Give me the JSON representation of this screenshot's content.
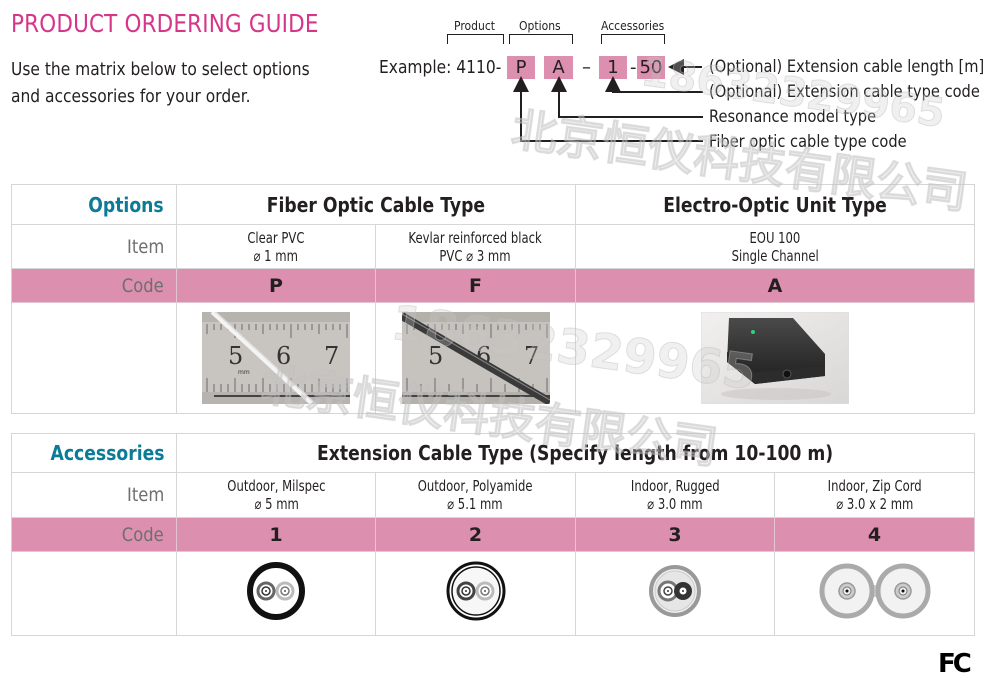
{
  "header": {
    "title": "PRODUCT ORDERING GUIDE",
    "intro_lines": [
      "Use the matrix below to select options",
      "and accessories for your order."
    ]
  },
  "example": {
    "prefix": "Example: 4110-",
    "group_labels": {
      "product": "Product",
      "options": "Options",
      "accessories": "Accessories"
    },
    "codes": [
      "P",
      "A",
      "1",
      "50"
    ],
    "separators": [
      "–",
      "-"
    ],
    "legend": [
      "(Optional) Extension cable length [m]",
      "(Optional) Extension cable type code",
      "Resonance model type",
      "Fiber optic cable type code"
    ],
    "highlight_color": "#dc8fae"
  },
  "options_table": {
    "section_label": "Options",
    "groups": [
      "Fiber Optic Cable Type",
      "Electro-Optic Unit Type"
    ],
    "row_labels": {
      "item": "Item",
      "code": "Code"
    },
    "columns": [
      {
        "item_line1": "Clear PVC",
        "item_line2": "⌀ 1 mm",
        "code": "P",
        "image": "clear-fiber-on-ruler"
      },
      {
        "item_line1": "Kevlar reinforced black",
        "item_line2": "PVC ⌀ 3 mm",
        "code": "F",
        "image": "black-fiber-on-ruler"
      },
      {
        "item_line1": "EOU 100",
        "item_line2": "Single Channel",
        "code": "A",
        "image": "electro-optic-unit"
      }
    ],
    "ruler_numbers": [
      "5",
      "6",
      "7"
    ],
    "ruler_unit": "mm"
  },
  "accessories_table": {
    "section_label": "Accessories",
    "group": "Extension Cable Type (Specify length from 10-100 m)",
    "row_labels": {
      "item": "Item",
      "code": "Code"
    },
    "columns": [
      {
        "item_line1": "Outdoor, Milspec",
        "item_line2": "⌀ 5 mm",
        "code": "1",
        "image": "cable-cross-section-milspec"
      },
      {
        "item_line1": "Outdoor, Polyamide",
        "item_line2": "⌀ 5.1 mm",
        "code": "2",
        "image": "cable-cross-section-polyamide"
      },
      {
        "item_line1": "Indoor, Rugged",
        "item_line2": "⌀ 3.0 mm",
        "code": "3",
        "image": "cable-cross-section-rugged"
      },
      {
        "item_line1": "Indoor, Zip Cord",
        "item_line2": "⌀ 3.0 x 2 mm",
        "code": "4",
        "image": "cable-cross-section-zipcord"
      }
    ]
  },
  "watermark": {
    "phone": "18632329965",
    "company": "北京恒仪科技有限公司"
  },
  "footer": {
    "logo": "FC"
  },
  "colors": {
    "title": "#d6368a",
    "section_label": "#0b7b98",
    "code_row": "#dc8fae",
    "border": "#d6d6d6"
  }
}
